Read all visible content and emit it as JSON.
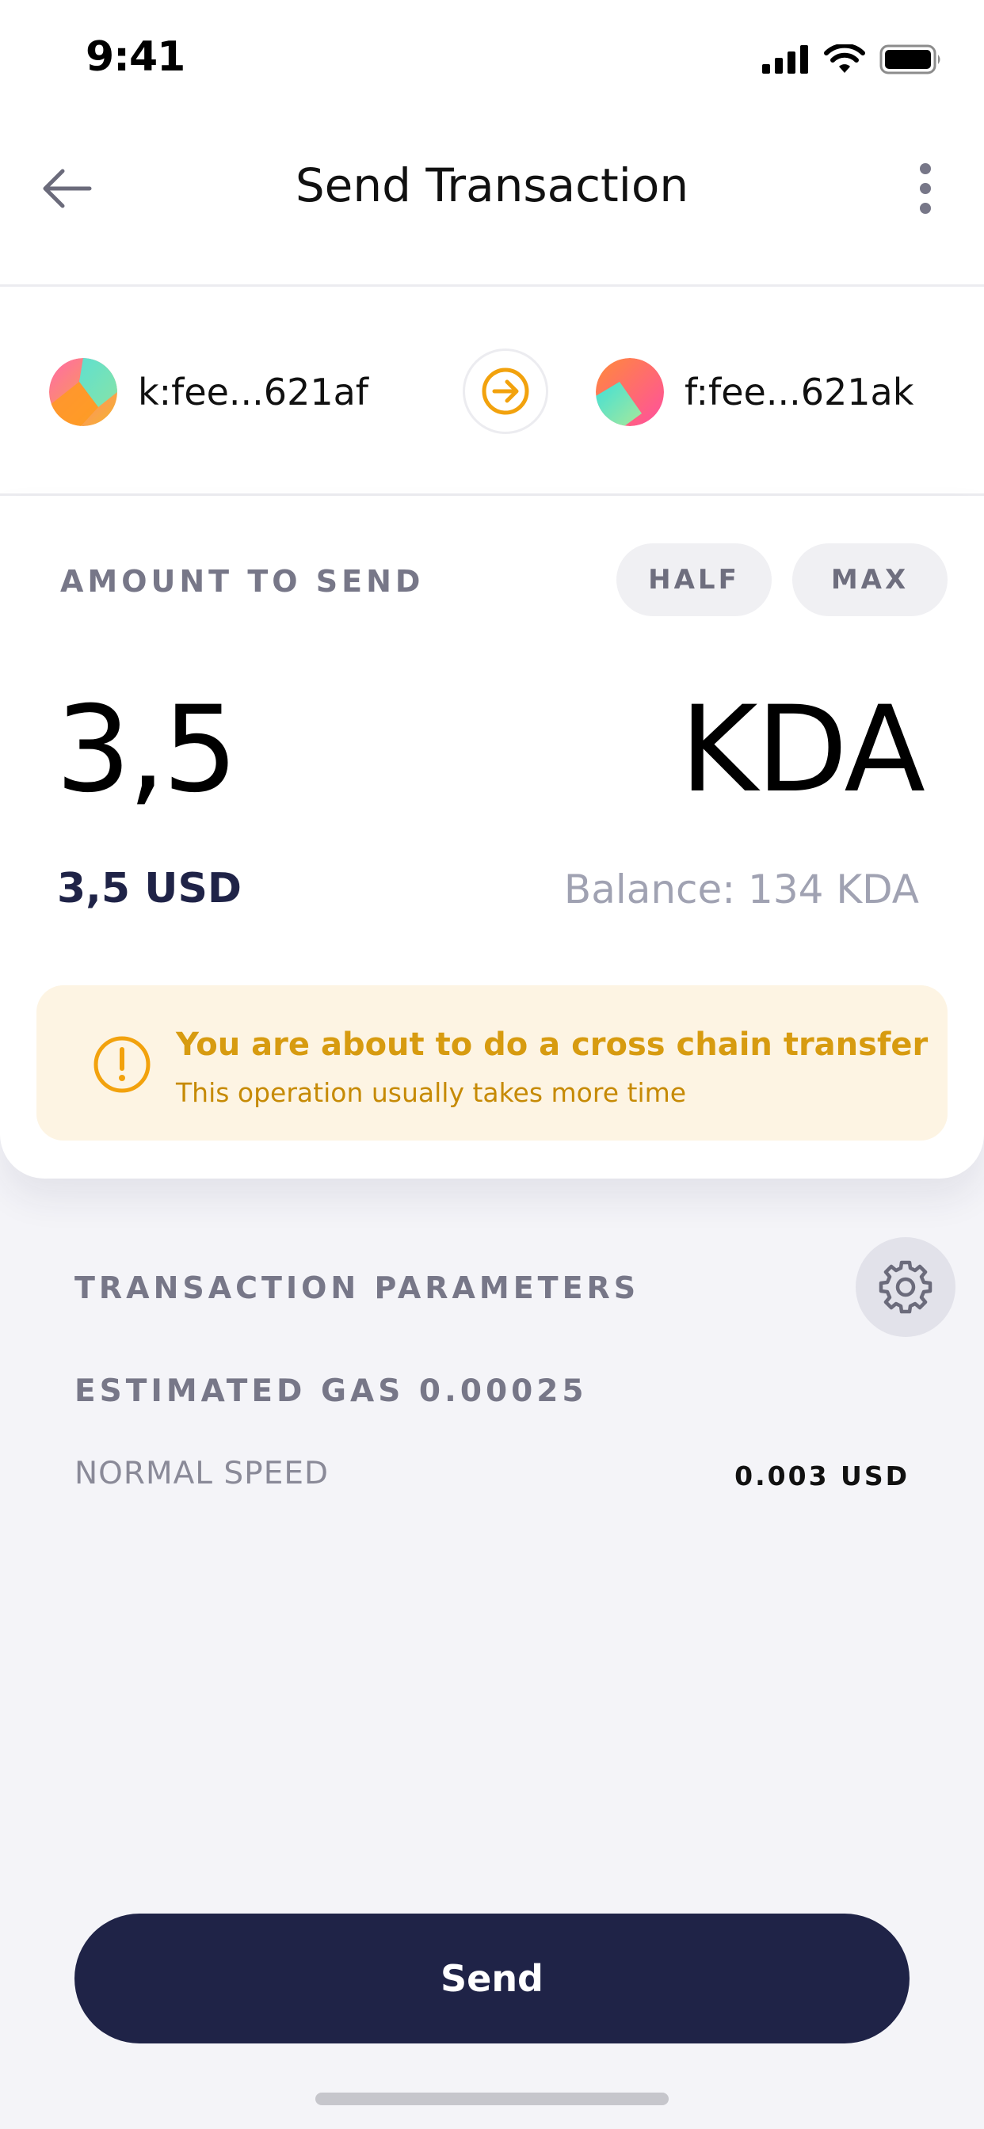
{
  "status_bar": {
    "time": "9:41"
  },
  "header": {
    "title": "Send Transaction"
  },
  "accounts": {
    "from": {
      "label": "k:fee...621af"
    },
    "to": {
      "label": "f:fee...621ak"
    }
  },
  "amount": {
    "section_label": "AMOUNT TO SEND",
    "half_label": "HALF",
    "max_label": "MAX",
    "value": "3,5",
    "token": "KDA",
    "usd_value": "3,5 USD",
    "balance": "Balance: 134 KDA"
  },
  "warning": {
    "title": "You are about to do a cross chain transfer",
    "subtitle": "This operation usually takes more time"
  },
  "params": {
    "section_label": "TRANSACTION PARAMETERS",
    "gas_label": "ESTIMATED GAS 0.00025",
    "speed_label": "NORMAL SPEED",
    "speed_value": "0.003 USD"
  },
  "send_button": {
    "label": "Send"
  },
  "colors": {
    "primary": "#1f2347",
    "warning_accent": "#f2a20d",
    "warning_bg": "#fdf4e3"
  }
}
